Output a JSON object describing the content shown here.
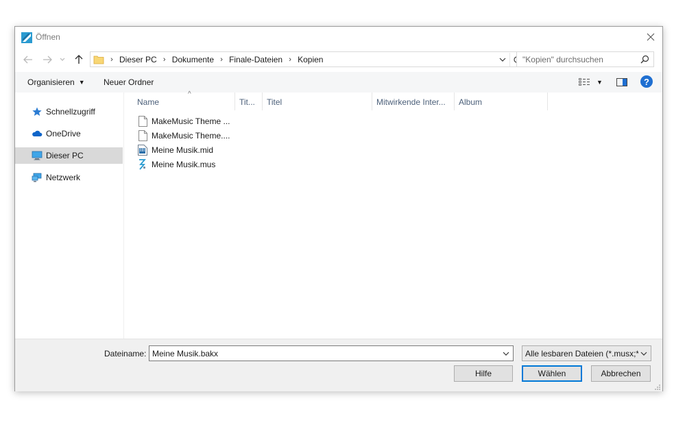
{
  "window": {
    "title": "Öffnen"
  },
  "address": {
    "crumbs": [
      "Dieser PC",
      "Dokumente",
      "Finale-Dateien",
      "Kopien"
    ],
    "search_placeholder": "\"Kopien\" durchsuchen"
  },
  "toolbar": {
    "organize_label": "Organisieren",
    "new_folder_label": "Neuer Ordner"
  },
  "sidebar": {
    "items": [
      {
        "label": "Schnellzugriff",
        "icon": "star-icon"
      },
      {
        "label": "OneDrive",
        "icon": "cloud-icon"
      },
      {
        "label": "Dieser PC",
        "icon": "computer-icon",
        "selected": true
      },
      {
        "label": "Netzwerk",
        "icon": "network-icon"
      }
    ]
  },
  "file_list": {
    "columns": [
      "Name",
      "Tit...",
      "Titel",
      "Mitwirkende Inter...",
      "Album"
    ],
    "files": [
      {
        "name": "MakeMusic Theme ...",
        "icon": "blank-document-icon"
      },
      {
        "name": "MakeMusic Theme....",
        "icon": "blank-document-icon"
      },
      {
        "name": "Meine Musik.mid",
        "icon": "midi-file-icon"
      },
      {
        "name": "Meine Musik.mus",
        "icon": "finale-file-icon"
      }
    ]
  },
  "bottom": {
    "filename_label": "Dateiname:",
    "filename_value": "Meine Musik.bakx",
    "filter_value": "Alle lesbaren Dateien (*.musx;*.",
    "help_label": "Hilfe",
    "choose_label": "Wählen",
    "cancel_label": "Abbrechen"
  },
  "colors": {
    "accent": "#0078d7",
    "selection": "#d9d9d9",
    "header_text": "#4c607a"
  }
}
